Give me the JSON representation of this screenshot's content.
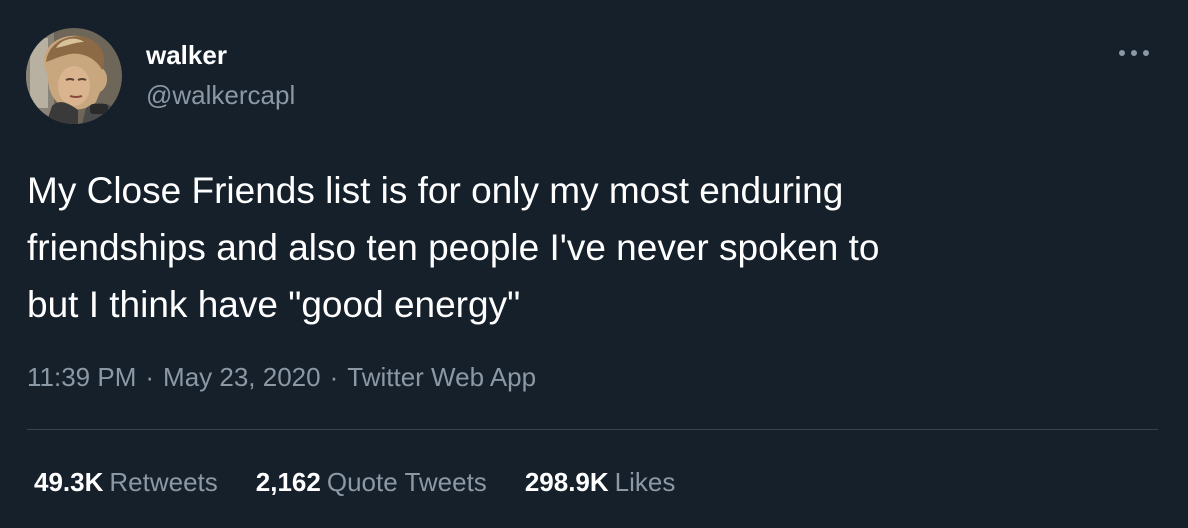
{
  "user": {
    "display_name": "walker",
    "handle": "@walkercapl"
  },
  "tweet": {
    "text_lines": [
      "My Close Friends list is for only my most enduring",
      "friendships and also ten people I've never spoken to",
      "but I think have \"good energy\""
    ]
  },
  "meta": {
    "time": "11:39 PM",
    "separator": "·",
    "date": "May 23, 2020",
    "source": "Twitter Web App"
  },
  "stats": {
    "retweets_count": "49.3K",
    "retweets_label": "Retweets",
    "quotes_count": "2,162",
    "quotes_label": "Quote Tweets",
    "likes_count": "298.9K",
    "likes_label": "Likes"
  },
  "icons": {
    "more": "more-horizontal-icon"
  },
  "colors": {
    "background": "#15202b",
    "primary_text": "#ffffff",
    "secondary_text": "#8b98a5",
    "divider": "#38444d"
  }
}
